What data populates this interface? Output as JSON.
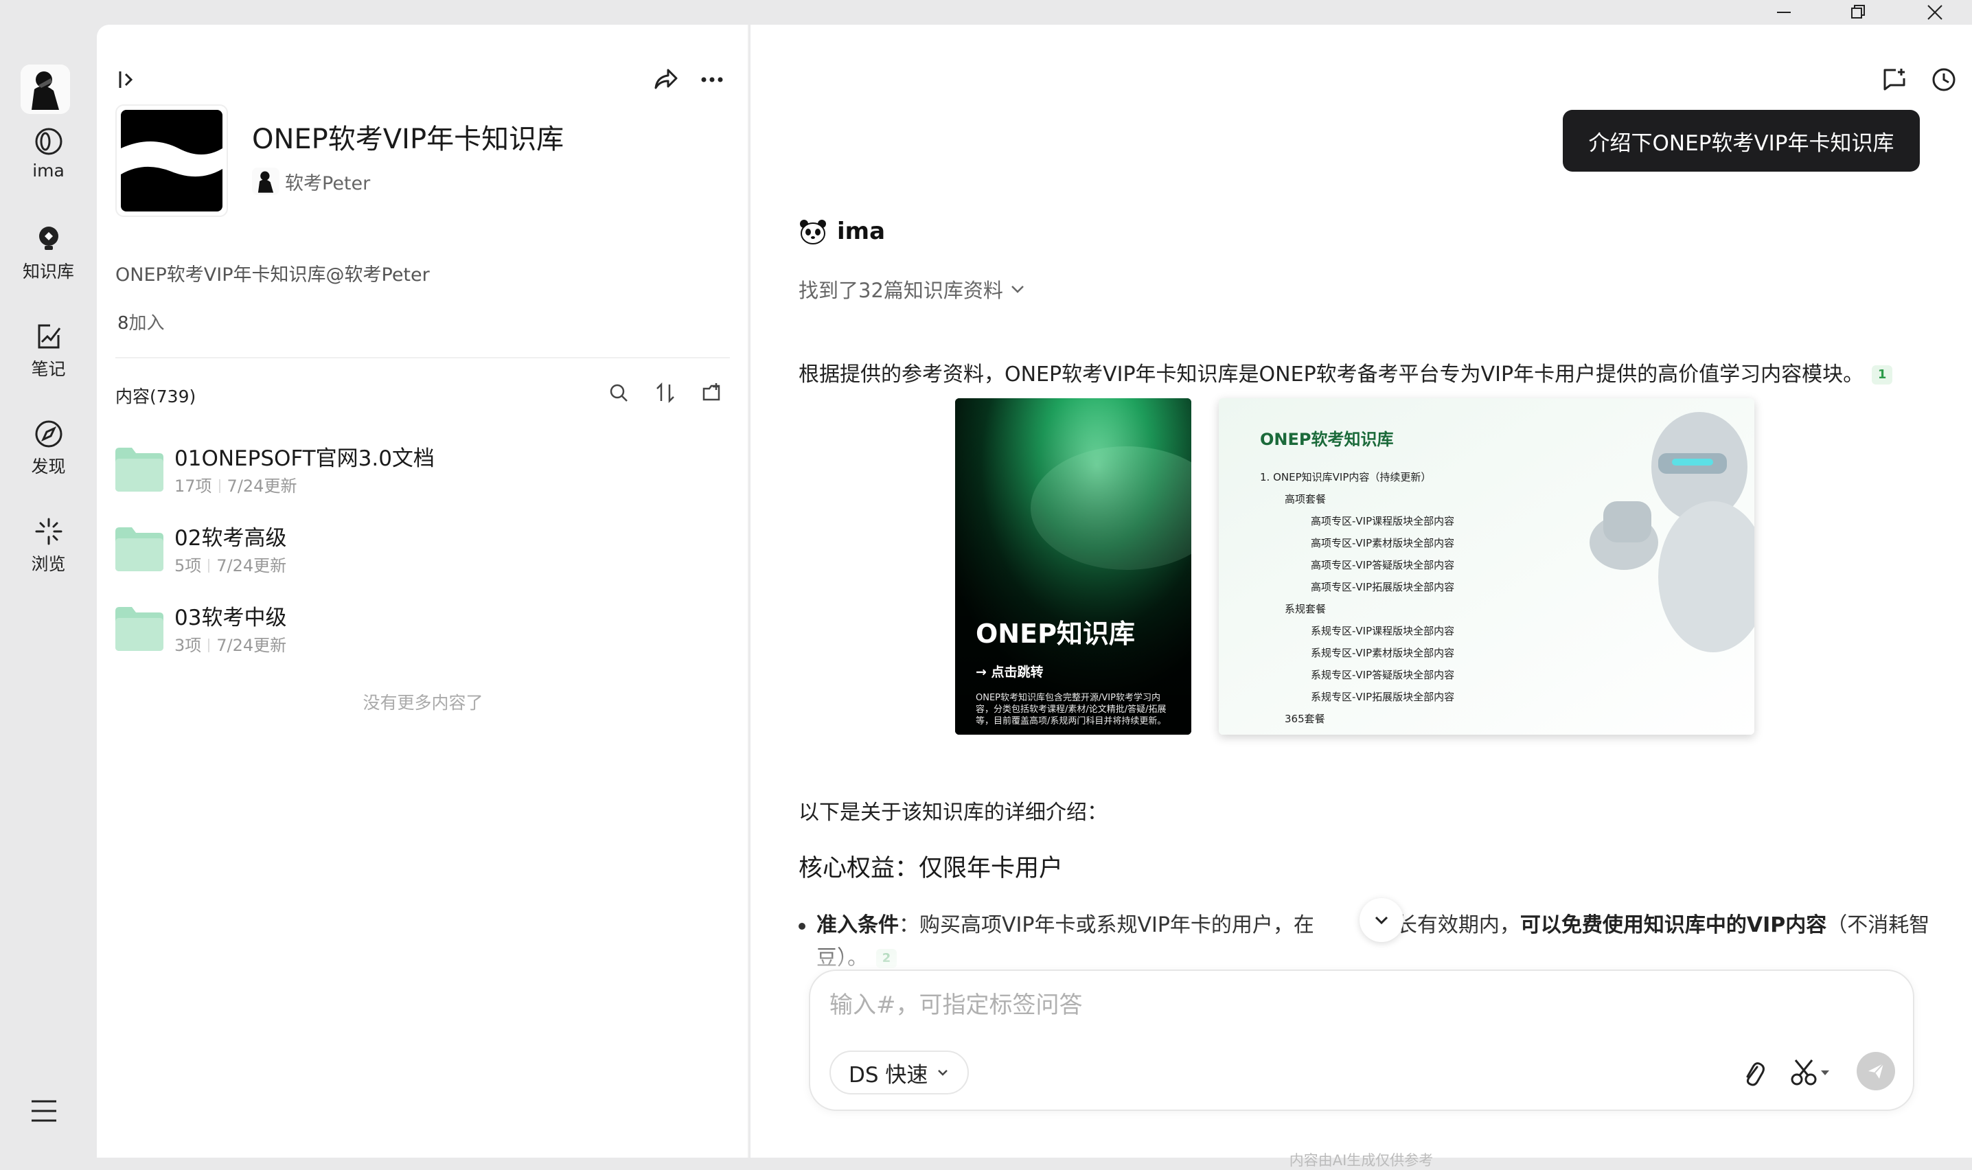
{
  "rail": {
    "items": [
      {
        "label": "ima"
      },
      {
        "label": "知识库"
      },
      {
        "label": "笔记"
      },
      {
        "label": "发现"
      },
      {
        "label": "浏览"
      }
    ]
  },
  "kb": {
    "title": "ONEP软考VIP年卡知识库",
    "author": "软考Peter",
    "description": "ONEP软考VIP年卡知识库@软考Peter",
    "joined_count": "8",
    "joined_label": "加入",
    "content_label": "内容(739)"
  },
  "folders": [
    {
      "name": "01ONEPSOFT官网3.0文档",
      "count": "17项",
      "updated": "7/24更新"
    },
    {
      "name": "02软考高级",
      "count": "5项",
      "updated": "7/24更新"
    },
    {
      "name": "03软考中级",
      "count": "3项",
      "updated": "7/24更新"
    }
  ],
  "no_more": "没有更多内容了",
  "chat": {
    "suggest": "介绍下ONEP软考VIP年卡知识库",
    "bot_name": "ima",
    "found": "找到了32篇知识库资料",
    "intro": "根据提供的参考资料，ONEP软考VIP年卡知识库是ONEP软考备考平台专为VIP年卡用户提供的高价值学习内容模块。",
    "cite1": "1",
    "detail_intro": "以下是关于该知识库的详细介绍：",
    "section_title": "核心权益：仅限年卡用户",
    "bullet_strong": "准入条件",
    "bullet_text1": "：购买高项VIP年卡或系规VIP年卡的用户，在",
    "bullet_text2": "时长有效期内，",
    "bullet_strong2": "可以免费使用知识库中的VIP内容",
    "bullet_text3": "（不消耗智豆）。",
    "cite2": "2"
  },
  "card1": {
    "title": "ONEP知识库",
    "jump": "→ 点击跳转",
    "desc": "ONEP软考知识库包含完整开源/VIP软考学习内容，分类包括软考课程/素材/论文精批/答疑/拓展等，目前覆盖高项/系规两门科目并将持续更新。"
  },
  "card2": {
    "title": "ONEP软考知识库",
    "lines": [
      "1. ONEP知识库VIP内容（持续更新）",
      "高项套餐",
      "高项专区-VIP课程版块全部内容",
      "高项专区-VIP素材版块全部内容",
      "高项专区-VIP答疑版块全部内容",
      "高项专区-VIP拓展版块全部内容",
      "系规套餐",
      "系规专区-VIP课程版块全部内容",
      "系规专区-VIP素材版块全部内容",
      "系规专区-VIP答疑版块全部内容",
      "系规专区-VIP拓展版块全部内容",
      "365套餐"
    ]
  },
  "input": {
    "placeholder": "输入#，可指定标签问答",
    "value": "",
    "model": "DS 快速"
  },
  "disclaimer": "内容由AI生成仅供参考",
  "colors": {
    "accent_dark": "#1d1d1f",
    "folder_green": "#a6e0c2",
    "cite_green": "#2d9b4a"
  }
}
